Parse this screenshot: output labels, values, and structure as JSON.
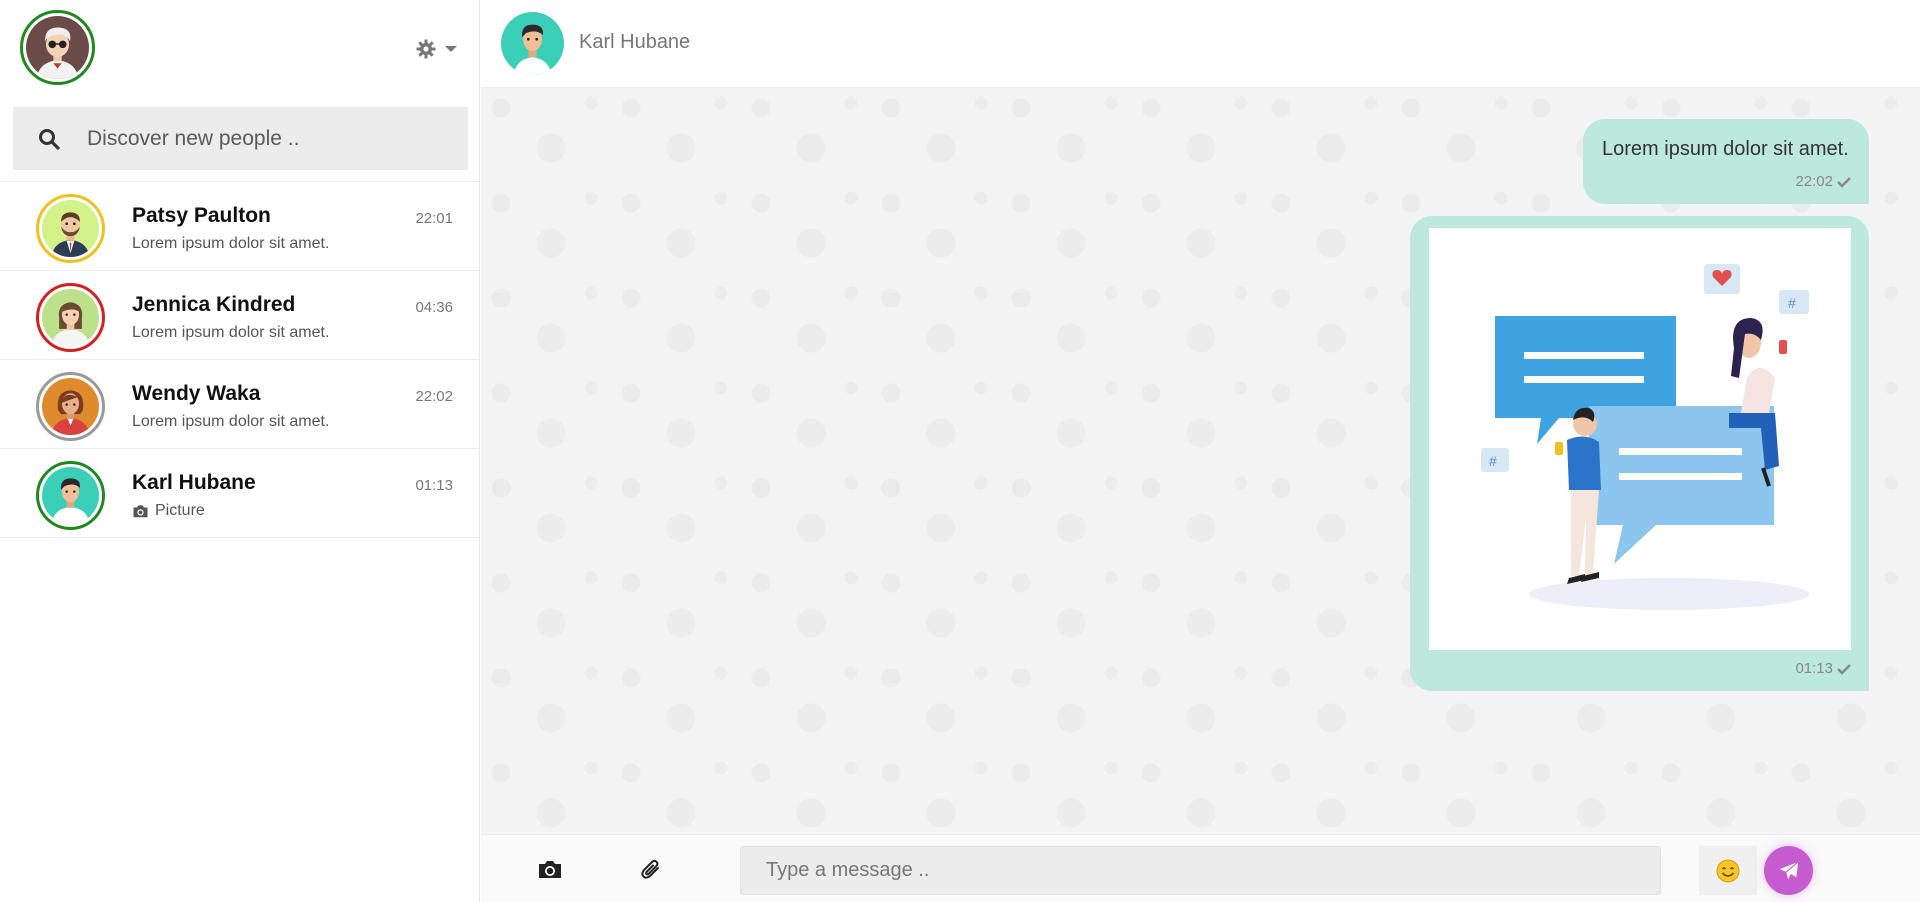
{
  "me": {
    "avatar_icon": "user-avatar-sunglasses",
    "status_color": "#1e8a1e"
  },
  "settings": {
    "icon": "gear-icon",
    "dropdown": "caret-down-icon"
  },
  "search": {
    "placeholder": "Discover new people .."
  },
  "contacts": [
    {
      "name": "Patsy Paulton",
      "last_message": "Lorem ipsum dolor sit amet.",
      "time": "22:01",
      "ring_color": "#f0c21e"
    },
    {
      "name": "Jennica Kindred",
      "last_message": "Lorem ipsum dolor sit amet.",
      "time": "04:36",
      "ring_color": "#d42020"
    },
    {
      "name": "Wendy Waka",
      "last_message": "Lorem ipsum dolor sit amet.",
      "time": "22:02",
      "ring_color": "#9a9a9a"
    },
    {
      "name": "Karl Hubane",
      "last_message": "Picture",
      "last_message_icon": "camera-icon",
      "time": "01:13",
      "ring_color": "#1e8a1e"
    }
  ],
  "chat": {
    "contact_name": "Karl Hubane",
    "messages": [
      {
        "type": "text",
        "text": "Lorem ipsum dolor sit amet.",
        "time": "22:02",
        "status_icon": "check-icon"
      },
      {
        "type": "image",
        "image_icon": "chat-illustration",
        "time": "01:13",
        "status_icon": "check-icon"
      }
    ]
  },
  "composer": {
    "placeholder": "Type a message ..",
    "camera_icon": "camera-icon",
    "attach_icon": "paperclip-icon",
    "emoji_icon": "smile-emoji-icon",
    "send_icon": "paper-plane-icon",
    "send_color": "#c65bcf"
  },
  "colors": {
    "bubble": "#bde8dd",
    "accent": "#c65bcf"
  }
}
